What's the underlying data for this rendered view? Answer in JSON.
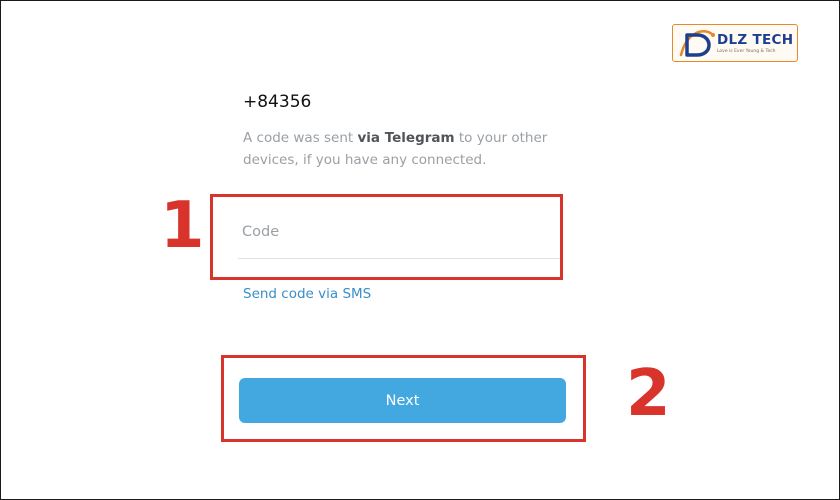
{
  "logo": {
    "brand": "DLZ TECH",
    "tagline": "Love is Ever Young & Tech"
  },
  "login": {
    "phone_number": "+84356",
    "message_prefix": "A code was sent ",
    "message_highlight": "via Telegram",
    "message_suffix": " to your other devices, if you have any connected.",
    "code_placeholder": "Code",
    "code_value": "",
    "sms_link_label": "Send code via SMS",
    "next_label": "Next"
  },
  "annotations": {
    "step_1": "1",
    "step_2": "2"
  },
  "colors": {
    "accent_blue": "#44a8e0",
    "link_blue": "#3a8fc7",
    "annotation_red": "#d9342b",
    "logo_blue": "#1c3f8f",
    "logo_orange": "#e38a2b"
  }
}
